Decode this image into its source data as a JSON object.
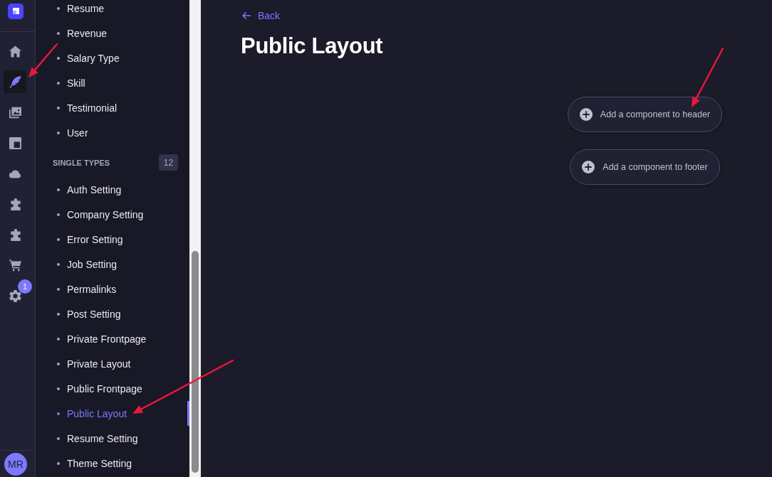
{
  "rail": {
    "items": [
      {
        "kind": "home",
        "selected": false
      },
      {
        "kind": "feather",
        "selected": true
      },
      {
        "kind": "images",
        "selected": false
      },
      {
        "kind": "layout",
        "selected": false
      },
      {
        "kind": "cloud",
        "selected": false
      },
      {
        "kind": "puzzle",
        "selected": false
      },
      {
        "kind": "puzzle",
        "selected": false
      },
      {
        "kind": "cart",
        "selected": false
      },
      {
        "kind": "settings",
        "selected": false,
        "badge": "1"
      }
    ],
    "avatar": "MR"
  },
  "sidebar": {
    "sections": [
      {
        "items": [
          {
            "label": "Resume",
            "selected": false
          },
          {
            "label": "Revenue",
            "selected": false
          },
          {
            "label": "Salary Type",
            "selected": false
          },
          {
            "label": "Skill",
            "selected": false
          },
          {
            "label": "Testimonial",
            "selected": false
          },
          {
            "label": "User",
            "selected": false
          }
        ]
      },
      {
        "title": "SINGLE TYPES",
        "count": "12",
        "items": [
          {
            "label": "Auth Setting",
            "selected": false
          },
          {
            "label": "Company Setting",
            "selected": false
          },
          {
            "label": "Error Setting",
            "selected": false
          },
          {
            "label": "Job Setting",
            "selected": false
          },
          {
            "label": "Permalinks",
            "selected": false
          },
          {
            "label": "Post Setting",
            "selected": false
          },
          {
            "label": "Private Frontpage",
            "selected": false
          },
          {
            "label": "Private Layout",
            "selected": false
          },
          {
            "label": "Public Frontpage",
            "selected": false
          },
          {
            "label": "Public Layout",
            "selected": true
          },
          {
            "label": "Resume Setting",
            "selected": false
          },
          {
            "label": "Theme Setting",
            "selected": false
          }
        ]
      }
    ]
  },
  "main": {
    "back_link": "Back",
    "title": "Public Layout",
    "buttons": [
      {
        "label": "Add a component to header"
      },
      {
        "label": "Add a component to footer"
      }
    ]
  },
  "annotations": [
    {
      "kind": "arrow"
    },
    {
      "kind": "arrow"
    },
    {
      "kind": "arrow"
    }
  ]
}
